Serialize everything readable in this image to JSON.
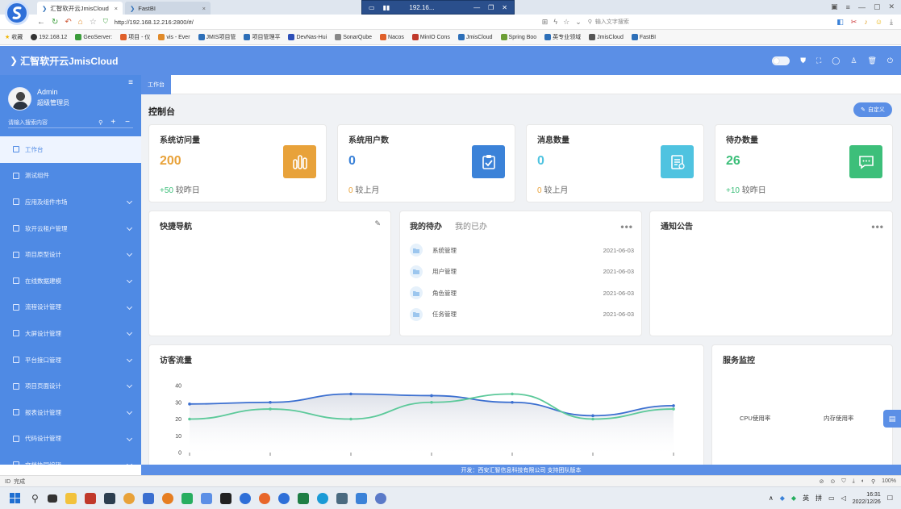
{
  "browser": {
    "tabs": [
      {
        "title": "汇智软开云JmisCloud",
        "active": true
      },
      {
        "title": "FastBI",
        "active": false
      }
    ],
    "url": "http://192.168.12.216:2800/#/",
    "search_placeholder": "输入文字搜索",
    "remote_title": "192.16...",
    "bookmarks": [
      {
        "label": "收藏",
        "color": "#f0b400"
      },
      {
        "label": "192.168.12",
        "color": "#333333"
      },
      {
        "label": "GeoServer:",
        "color": "#3b9c3b"
      },
      {
        "label": "项目 - 仪",
        "color": "#e0602a"
      },
      {
        "label": "vis - Ever",
        "color": "#e08a2a"
      },
      {
        "label": "JMIS项目管",
        "color": "#2d6fb8"
      },
      {
        "label": "项目管理平",
        "color": "#2d6fb8"
      },
      {
        "label": "DevNas-Hui",
        "color": "#2d4fb8"
      },
      {
        "label": "SonarQube",
        "color": "#888888"
      },
      {
        "label": "Nacos",
        "color": "#e0602a"
      },
      {
        "label": "MinIO Cons",
        "color": "#c0392b"
      },
      {
        "label": "JmisCloud",
        "color": "#2d6fb8"
      },
      {
        "label": "Spring Boo",
        "color": "#6c9e35"
      },
      {
        "label": "英专业领域",
        "color": "#2d6fb8"
      },
      {
        "label": "JmisCloud",
        "color": "#555555"
      },
      {
        "label": "FastBI",
        "color": "#2d6fb8"
      }
    ]
  },
  "app": {
    "title": "汇智软开云JmisCloud",
    "user_name": "Admin",
    "user_role": "超级管理员",
    "search_placeholder": "请输入搜索内容",
    "tab_workbench": "工作台",
    "page_title": "控制台",
    "customize_label": "自定义",
    "accent_color": "#5b8fe6"
  },
  "sidebar": {
    "items": [
      {
        "label": "工作台",
        "active": true,
        "chev": false
      },
      {
        "label": "测试组件",
        "active": false,
        "chev": false
      },
      {
        "label": "应用及组件市场",
        "active": false,
        "chev": true
      },
      {
        "label": "软开云租户管理",
        "active": false,
        "chev": true
      },
      {
        "label": "项目原型设计",
        "active": false,
        "chev": true
      },
      {
        "label": "在线数据建模",
        "active": false,
        "chev": true
      },
      {
        "label": "流程设计管理",
        "active": false,
        "chev": true
      },
      {
        "label": "大屏设计管理",
        "active": false,
        "chev": true
      },
      {
        "label": "平台接口管理",
        "active": false,
        "chev": true
      },
      {
        "label": "项目页面设计",
        "active": false,
        "chev": true
      },
      {
        "label": "报表设计管理",
        "active": false,
        "chev": true
      },
      {
        "label": "代码设计管理",
        "active": false,
        "chev": true
      },
      {
        "label": "文档协同编辑",
        "active": false,
        "chev": true
      }
    ]
  },
  "stats": [
    {
      "title": "系统访问量",
      "value": "200",
      "sub_value": "+50",
      "sub_label": "较昨日",
      "color": "#e8a23a",
      "icon": "bar-chart-icon"
    },
    {
      "title": "系统用户数",
      "value": "0",
      "sub_value": "0",
      "sub_label": "较上月",
      "color": "#3b82d8",
      "icon": "clipboard-check-icon"
    },
    {
      "title": "消息数量",
      "value": "0",
      "sub_value": "0",
      "sub_label": "较上月",
      "color": "#4fc3e0",
      "icon": "document-icon"
    },
    {
      "title": "待办数量",
      "value": "26",
      "sub_value": "+10",
      "sub_label": "较昨日",
      "color": "#3dbf7a",
      "icon": "message-icon"
    }
  ],
  "quick_nav": {
    "title": "快捷导航"
  },
  "todo": {
    "tab_mine": "我的待办",
    "tab_done": "我的已办",
    "items": [
      {
        "label": "系统管理",
        "date": "2021-06-03"
      },
      {
        "label": "用户管理",
        "date": "2021-06-03"
      },
      {
        "label": "角色管理",
        "date": "2021-06-03"
      },
      {
        "label": "任务管理",
        "date": "2021-06-03"
      }
    ]
  },
  "notice": {
    "title": "通知公告"
  },
  "traffic": {
    "title": "访客流量"
  },
  "monitor": {
    "title": "服务监控",
    "cpu_label": "CPU使用率",
    "mem_label": "内存使用率"
  },
  "chart_data": {
    "type": "line",
    "title": "访客流量",
    "ylim": [
      0,
      40
    ],
    "yticks": [
      0,
      10,
      20,
      30,
      40
    ],
    "series": [
      {
        "color": "#3b6fd0",
        "values": [
          29,
          30,
          35,
          34,
          30,
          22,
          28
        ]
      },
      {
        "color": "#5cc99a",
        "values": [
          20,
          26,
          20,
          30,
          35,
          20,
          26
        ]
      }
    ]
  },
  "footer": {
    "text": "开发：西安汇智信息科技有限公司 支持团队版本"
  },
  "statusbar": {
    "left": "完成",
    "zoom": "100%"
  },
  "taskbar": {
    "ime": "英",
    "ime2": "拼",
    "time": "16:31",
    "date": "2022/12/26"
  }
}
